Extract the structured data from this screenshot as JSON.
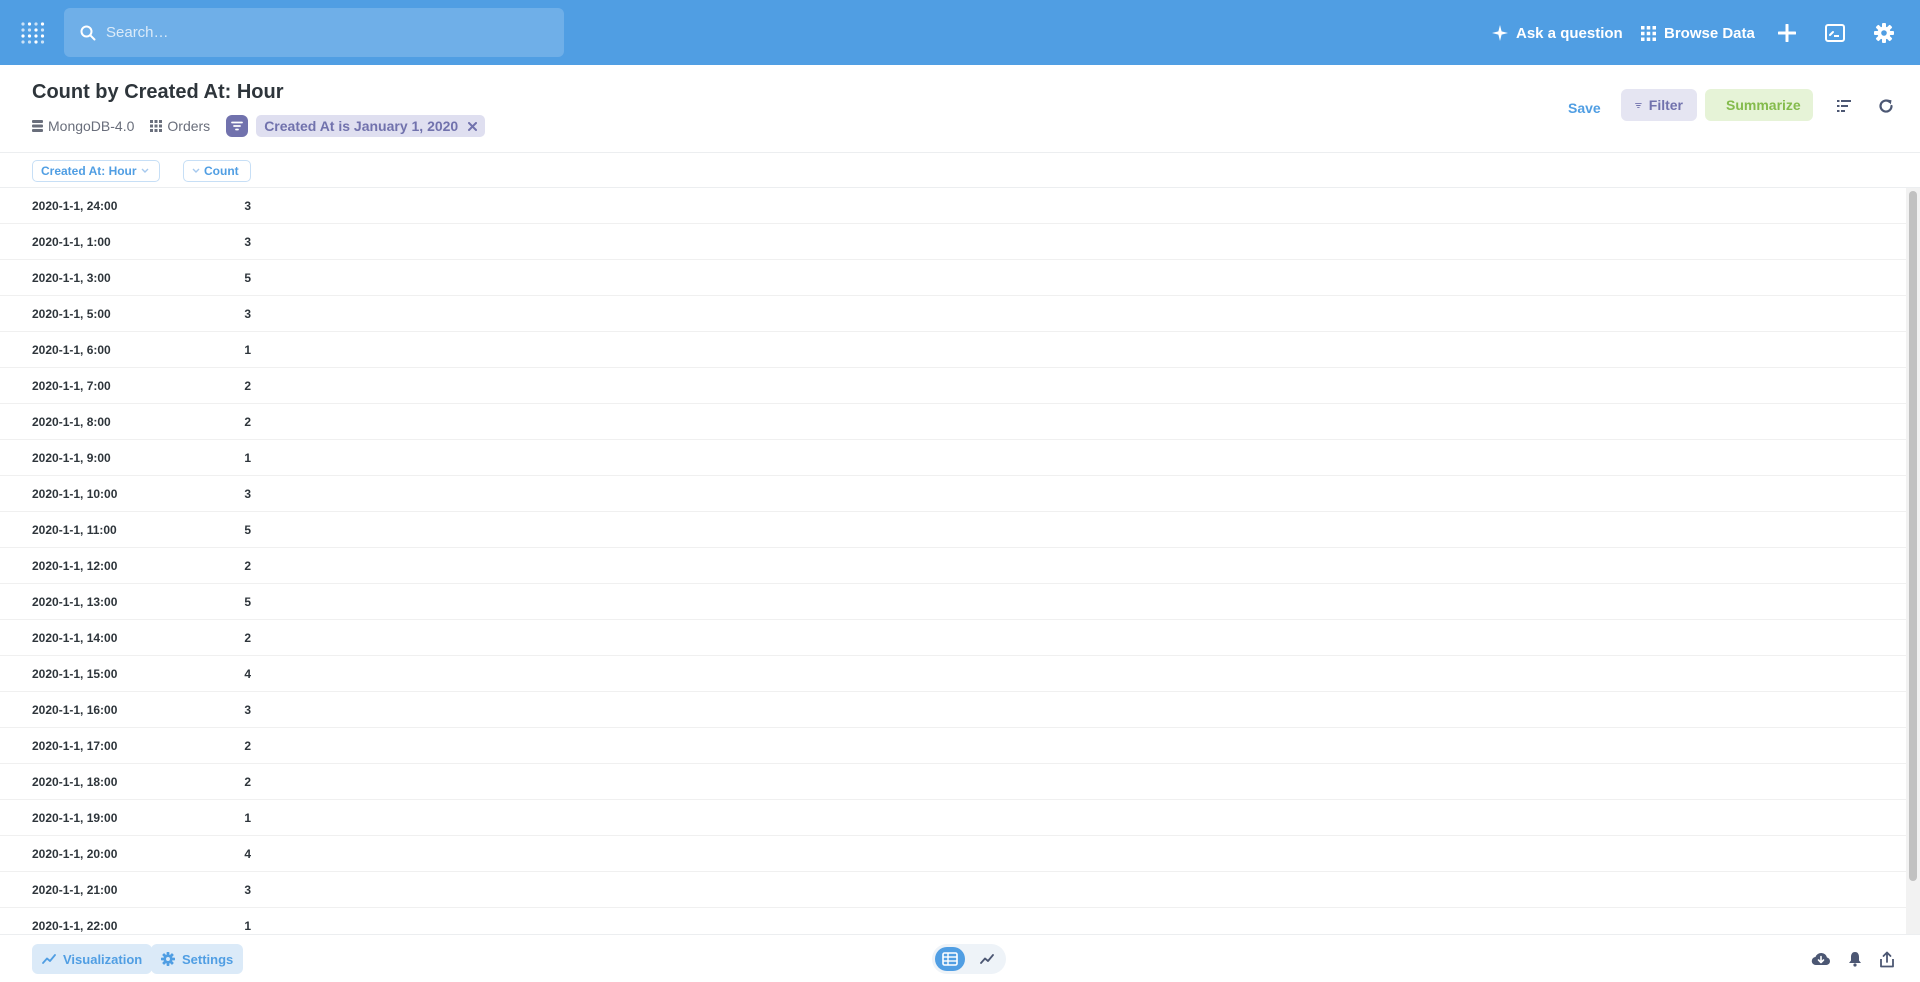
{
  "colors": {
    "nav": "#509ee3",
    "filter": "#7172ad",
    "summarize": "#84bb4c",
    "text": "#2e353b"
  },
  "nav": {
    "search_placeholder": "Search…",
    "ask_label": "Ask a question",
    "browse_label": "Browse Data",
    "icons": [
      "logo-icon",
      "search-icon",
      "sparkle-icon",
      "grid-icon",
      "plus-icon",
      "terminal-icon",
      "gear-icon"
    ]
  },
  "header": {
    "title": "Count by Created At: Hour",
    "database": "MongoDB-4.0",
    "table": "Orders",
    "filter_pill": "Created At is January 1, 2020",
    "save_label": "Save",
    "filter_label": "Filter",
    "summarize_label": "Summarize"
  },
  "table": {
    "columns": [
      "Created At: Hour",
      "Count"
    ],
    "rows": [
      [
        "2020-1-1, 24:00",
        "3"
      ],
      [
        "2020-1-1, 1:00",
        "3"
      ],
      [
        "2020-1-1, 3:00",
        "5"
      ],
      [
        "2020-1-1, 5:00",
        "3"
      ],
      [
        "2020-1-1, 6:00",
        "1"
      ],
      [
        "2020-1-1, 7:00",
        "2"
      ],
      [
        "2020-1-1, 8:00",
        "2"
      ],
      [
        "2020-1-1, 9:00",
        "1"
      ],
      [
        "2020-1-1, 10:00",
        "3"
      ],
      [
        "2020-1-1, 11:00",
        "5"
      ],
      [
        "2020-1-1, 12:00",
        "2"
      ],
      [
        "2020-1-1, 13:00",
        "5"
      ],
      [
        "2020-1-1, 14:00",
        "2"
      ],
      [
        "2020-1-1, 15:00",
        "4"
      ],
      [
        "2020-1-1, 16:00",
        "3"
      ],
      [
        "2020-1-1, 17:00",
        "2"
      ],
      [
        "2020-1-1, 18:00",
        "2"
      ],
      [
        "2020-1-1, 19:00",
        "1"
      ],
      [
        "2020-1-1, 20:00",
        "4"
      ],
      [
        "2020-1-1, 21:00",
        "3"
      ],
      [
        "2020-1-1, 22:00",
        "1"
      ]
    ]
  },
  "footer": {
    "visualization_label": "Visualization",
    "settings_label": "Settings"
  }
}
